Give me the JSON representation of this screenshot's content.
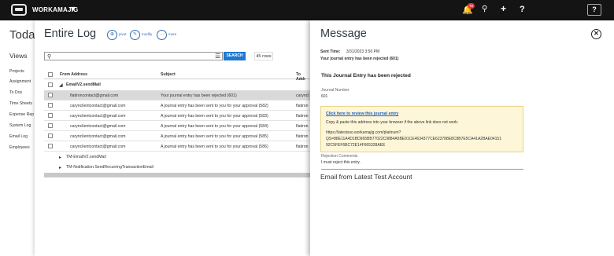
{
  "topbar": {
    "brand": "WORKAMAJIG",
    "notification_count": "78",
    "help_label": "?",
    "help_box_label": "?"
  },
  "background_page": {
    "title": "Toda",
    "views_label": "Views",
    "nav_items": [
      "Projects",
      "Assignment",
      "To Dos",
      "Time Sheets",
      "Expense Rep",
      "System Log",
      "Email Log",
      "Employees"
    ]
  },
  "log_panel": {
    "title": "Entire Log",
    "actions": [
      {
        "label": "pivot",
        "icon": "pivot-icon"
      },
      {
        "label": "modify",
        "icon": "pencil-icon"
      },
      {
        "label": "more",
        "icon": "more-icon"
      }
    ],
    "search": {
      "value": "",
      "placeholder": ""
    },
    "search_button": "SEARCH",
    "row_count": "45 rows",
    "columns": [
      "From Address",
      "Subject",
      "To Addr"
    ],
    "group1_label": "EmailV2.sendMail",
    "rows": [
      {
        "from": "flatironcontact@gmail.com",
        "subject": "Your journal entry has been rejected (601)",
        "to": "caryncl",
        "selected": true
      },
      {
        "from": "carynclientcontact@gmail.com",
        "subject": "A journal entry has been sent to you for your approval (582)",
        "to": "flatiron",
        "selected": false
      },
      {
        "from": "carynclientcontact@gmail.com",
        "subject": "A journal entry has been sent to you for your approval (583)",
        "to": "flatiron",
        "selected": false
      },
      {
        "from": "carynclientcontact@gmail.com",
        "subject": "A journal entry has been sent to you for your approval (584)",
        "to": "flatiron",
        "selected": false
      },
      {
        "from": "carynclientcontact@gmail.com",
        "subject": "A journal entry has been sent to you for your approval (585)",
        "to": "flatiron",
        "selected": false
      },
      {
        "from": "carynclientcontact@gmail.com",
        "subject": "A journal entry has been sent to you for your approval (586)",
        "to": "flatiron",
        "selected": false
      }
    ],
    "group2_label": "TM-EmailV2.sendMail",
    "group3_label": "TM-Notification.SendRecurringTransactionEmail"
  },
  "message_panel": {
    "title": "Message",
    "sent_time_label": "Sent Time:",
    "sent_time_value": "3/31/2023 3:50 PM",
    "subject_line": "Your journal entry has been rejected (601)",
    "email_heading": "This Journal Entry has been rejected",
    "journal_number_label": "Journal Number",
    "journal_number_value": "601",
    "link_text": "Click here to review this journal entry",
    "copy_instruction": "Copy & paste this address into your browser if the above link does not work:",
    "url_line1": "https://latestsso.workamajig.com/platinum?",
    "url_line2": "QS=88E11A4D1BD965BB77022C9884A5BE91CE4634377CE623788E8C8B7E5CA41A2BAE04151",
    "url_line3": "92C5FEF6BC72E14F665328AEE",
    "rejection_label": "Rejection Comments",
    "rejection_value": "I must reject this entry.",
    "footer": "Email from Latest Test Account"
  },
  "colors": {
    "topbar": "#141414",
    "accent": "#1f78d1",
    "link": "#1f5fbf",
    "notice_bg": "#fdf6d8",
    "selected_row": "#d9d9d9"
  }
}
